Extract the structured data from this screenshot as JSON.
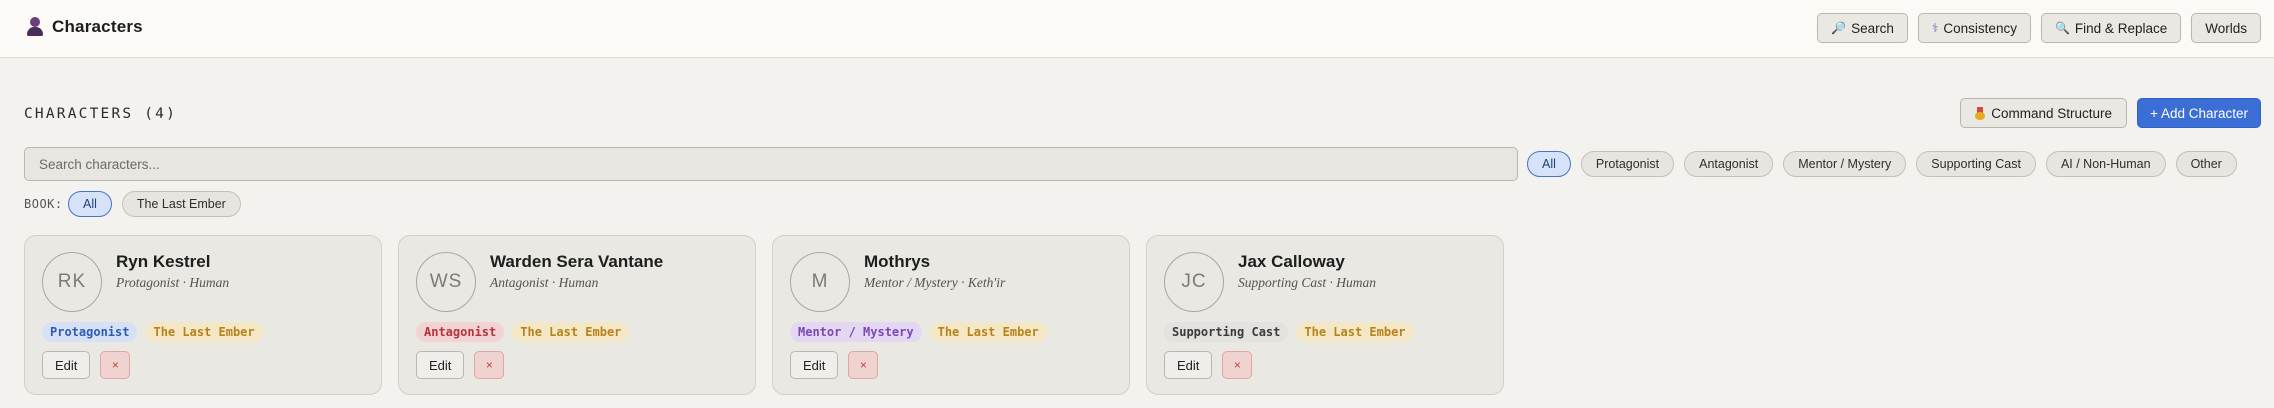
{
  "app": {
    "title": "Characters"
  },
  "toolbar": {
    "buttons": [
      {
        "label": "Search",
        "icon": "search-icon"
      },
      {
        "label": "Consistency",
        "icon": "stethoscope-icon"
      },
      {
        "label": "Find & Replace",
        "icon": "search-icon"
      },
      {
        "label": "Worlds"
      }
    ]
  },
  "section": {
    "title": "CHARACTERS (4)",
    "command_structure_label": "Command Structure",
    "add_character_label": "+ Add Character"
  },
  "search": {
    "placeholder": "Search characters..."
  },
  "role_filters": {
    "items": [
      "All",
      "Protagonist",
      "Antagonist",
      "Mentor / Mystery",
      "Supporting Cast",
      "AI / Non-Human",
      "Other"
    ],
    "selected": "All"
  },
  "book_filter": {
    "label": "BOOK:",
    "items": [
      "All",
      "The Last Ember"
    ],
    "selected": "All"
  },
  "cards": [
    {
      "initials": "RK",
      "name": "Ryn Kestrel",
      "subtitle": "Protagonist · Human",
      "role_tag": "Protagonist",
      "role_bg": "#d6e1f6",
      "role_color": "#2f5bb4",
      "book_tag": "The Last Ember",
      "edit_label": "Edit",
      "delete_label": "×"
    },
    {
      "initials": "WS",
      "name": "Warden Sera Vantane",
      "subtitle": "Antagonist · Human",
      "role_tag": "Antagonist",
      "role_bg": "#f2d3d3",
      "role_color": "#b8323a",
      "book_tag": "The Last Ember",
      "edit_label": "Edit",
      "delete_label": "×"
    },
    {
      "initials": "M",
      "name": "Mothrys",
      "subtitle": "Mentor / Mystery · Keth'ir",
      "role_tag": "Mentor / Mystery",
      "role_bg": "#e3d7f1",
      "role_color": "#7b46b8",
      "book_tag": "The Last Ember",
      "edit_label": "Edit",
      "delete_label": "×"
    },
    {
      "initials": "JC",
      "name": "Jax Calloway",
      "subtitle": "Supporting Cast · Human",
      "role_tag": "Supporting Cast",
      "role_bg": "#e3e2de",
      "role_color": "#3a3a3a",
      "book_tag": "The Last Ember",
      "edit_label": "Edit",
      "delete_label": "×"
    }
  ]
}
